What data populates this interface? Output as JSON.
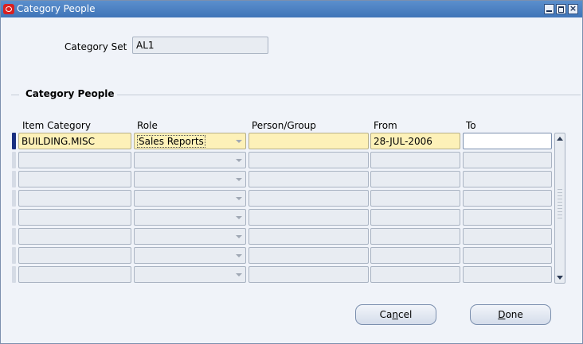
{
  "window": {
    "title": "Category People"
  },
  "header": {
    "category_set_label": "Category Set",
    "category_set_value": "AL1"
  },
  "section": {
    "title": "Category People"
  },
  "columns": [
    "Item Category",
    "Role",
    "Person/Group",
    "From",
    "To"
  ],
  "rows": [
    {
      "item_category": "BUILDING.MISC",
      "role": "Sales Reports",
      "person_group": "",
      "from": "28-JUL-2006",
      "to": ""
    },
    {
      "item_category": "",
      "role": "",
      "person_group": "",
      "from": "",
      "to": ""
    },
    {
      "item_category": "",
      "role": "",
      "person_group": "",
      "from": "",
      "to": ""
    },
    {
      "item_category": "",
      "role": "",
      "person_group": "",
      "from": "",
      "to": ""
    },
    {
      "item_category": "",
      "role": "",
      "person_group": "",
      "from": "",
      "to": ""
    },
    {
      "item_category": "",
      "role": "",
      "person_group": "",
      "from": "",
      "to": ""
    },
    {
      "item_category": "",
      "role": "",
      "person_group": "",
      "from": "",
      "to": ""
    },
    {
      "item_category": "",
      "role": "",
      "person_group": "",
      "from": "",
      "to": ""
    }
  ],
  "buttons": {
    "cancel_pre": "Ca",
    "cancel_mnemonic": "n",
    "cancel_post": "cel",
    "done_mnemonic": "D",
    "done_post": "one"
  },
  "icons": {
    "app": "oracle-icon",
    "minimize": "minimize-icon",
    "maximize": "maximize-icon",
    "close": "close-icon"
  }
}
